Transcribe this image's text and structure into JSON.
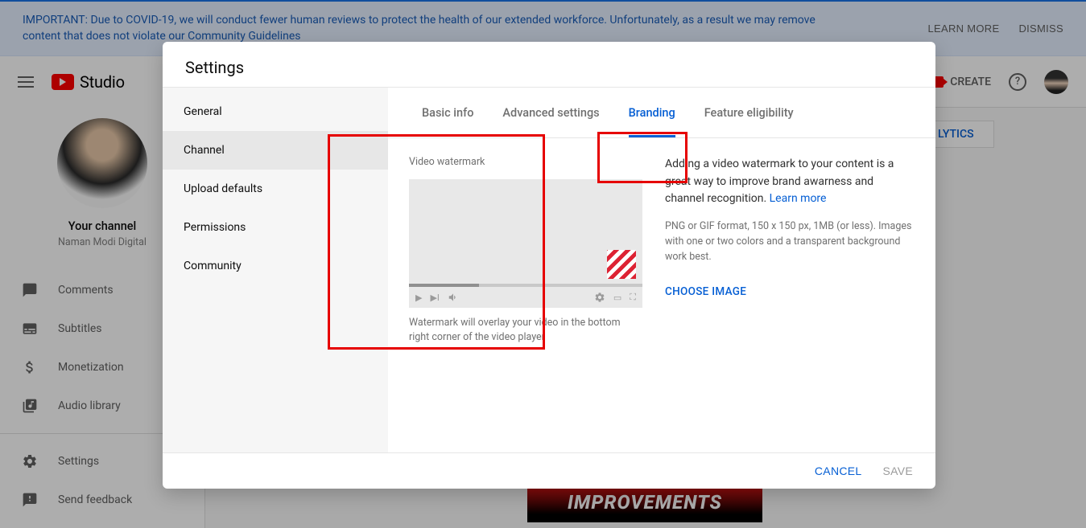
{
  "banner": {
    "text": "IMPORTANT: Due to COVID-19, we will conduct fewer human reviews to protect the health of our extended workforce. Unfortunately, as a result we may remove content that does not violate our Community Guidelines",
    "learn_more": "LEARN MORE",
    "dismiss": "DISMISS"
  },
  "topbar": {
    "logo": "Studio",
    "create": "CREATE"
  },
  "sidebar": {
    "channel_title": "Your channel",
    "channel_name": "Naman Modi Digital",
    "items": [
      {
        "label": "Comments"
      },
      {
        "label": "Subtitles"
      },
      {
        "label": "Monetization"
      },
      {
        "label": "Audio library"
      }
    ],
    "footer": [
      {
        "label": "Settings"
      },
      {
        "label": "Send feedback"
      }
    ]
  },
  "behind": {
    "analytics": "LYTICS",
    "thumb": "IMPROVEMENTS"
  },
  "dialog": {
    "title": "Settings",
    "nav": [
      {
        "label": "General"
      },
      {
        "label": "Channel",
        "active": true
      },
      {
        "label": "Upload defaults"
      },
      {
        "label": "Permissions"
      },
      {
        "label": "Community"
      }
    ],
    "tabs": [
      {
        "label": "Basic info"
      },
      {
        "label": "Advanced settings"
      },
      {
        "label": "Branding",
        "active": true
      },
      {
        "label": "Feature eligibility"
      }
    ],
    "section_label": "Video watermark",
    "preview_help": "Watermark will overlay your video in the bottom right corner of the video player",
    "desc": "Adding a video watermark to your content is a great way to improve brand awarness and channel recognition. ",
    "learn_more": "Learn more",
    "hint": "PNG or GIF format, 150 x 150 px, 1MB (or less). Images with one or two colors and a transparent background work best.",
    "choose": "CHOOSE IMAGE",
    "cancel": "CANCEL",
    "save": "SAVE"
  }
}
